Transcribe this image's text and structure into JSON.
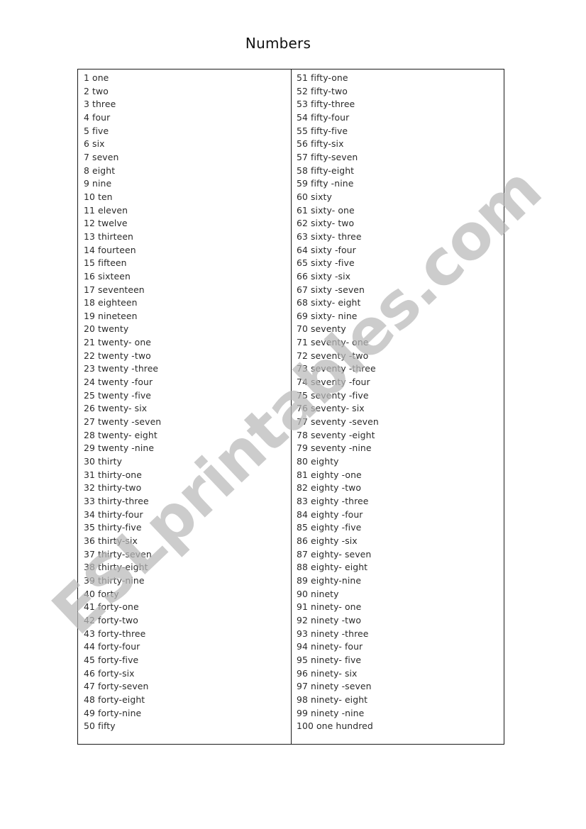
{
  "document": {
    "title": "Numbers",
    "watermark": "ESLprintables.com",
    "watermark_color": "#b9b9b9"
  },
  "columns": [
    {
      "rows": [
        "1 one",
        "2 two",
        "3 three",
        "4 four",
        "5 five",
        "6 six",
        "7 seven",
        "8 eight",
        "9 nine",
        "10 ten",
        "11 eleven",
        "12 twelve",
        "13 thirteen",
        "14 fourteen",
        "15 fifteen",
        "16 sixteen",
        "17 seventeen",
        "18 eighteen",
        "19 nineteen",
        "20 twenty",
        "21 twenty- one",
        "22 twenty -two",
        "23 twenty -three",
        "24 twenty -four",
        "25 twenty -five",
        "26 twenty- six",
        "27 twenty -seven",
        "28 twenty- eight",
        "29 twenty -nine",
        "30 thirty",
        "31 thirty-one",
        "32 thirty-two",
        "33 thirty-three",
        "34 thirty-four",
        "35 thirty-five",
        "36 thirty-six",
        "37 thirty-seven",
        "38 thirty-eight",
        "39 thirty-nine",
        "40 forty",
        "41 forty-one",
        "42 forty-two",
        "43 forty-three",
        "44 forty-four",
        "45 forty-five",
        "46 forty-six",
        "47 forty-seven",
        "48 forty-eight",
        "49 forty-nine",
        "50 fifty"
      ]
    },
    {
      "rows": [
        "51 fifty-one",
        "52 fifty-two",
        "53 fifty-three",
        "54 fifty-four",
        "55 fifty-five",
        "56 fifty-six",
        "57 fifty-seven",
        "58 fifty-eight",
        "59 fifty -nine",
        "60 sixty",
        "61 sixty- one",
        "62 sixty- two",
        "63 sixty- three",
        "64 sixty -four",
        "65 sixty -five",
        "66 sixty -six",
        "67 sixty -seven",
        "68 sixty- eight",
        "69 sixty- nine",
        "70 seventy",
        "71 seventy- one",
        "72 seventy -two",
        "73 seventy -three",
        "74 seventy -four",
        "75 seventy -five",
        "76 seventy- six",
        "77 seventy -seven",
        "78 seventy -eight",
        "79 seventy -nine",
        "80 eighty",
        "81 eighty -one",
        "82 eighty -two",
        "83 eighty -three",
        "84 eighty -four",
        "85 eighty -five",
        "86 eighty -six",
        "87 eighty- seven",
        "88 eighty- eight",
        "89 eighty-nine",
        "90 ninety",
        "91 ninety- one",
        "92 ninety -two",
        "93 ninety -three",
        "94 ninety- four",
        "95 ninety- five",
        "96 ninety- six",
        "97 ninety -seven",
        "98 ninety- eight",
        "99 ninety -nine",
        "100 one hundred"
      ]
    }
  ]
}
